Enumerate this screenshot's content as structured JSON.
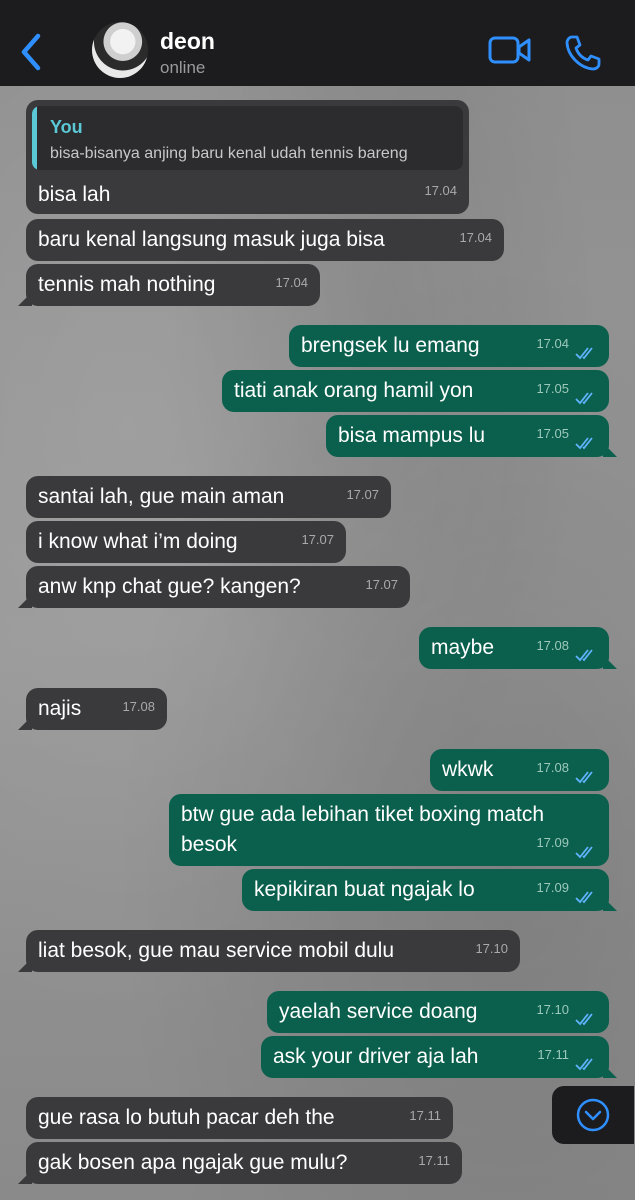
{
  "header": {
    "contact_name": "deon",
    "status": "online",
    "accent": "#2f8fff"
  },
  "quoted": {
    "author": "You",
    "text": "bisa-bisanya anjing baru kenal udah tennis bareng"
  },
  "messages": [
    {
      "dir": "in",
      "text": "bisa lah",
      "time": "17.04"
    },
    {
      "dir": "in",
      "text": "baru kenal langsung masuk juga bisa",
      "time": "17.04"
    },
    {
      "dir": "in",
      "text": "tennis mah nothing",
      "time": "17.04"
    },
    {
      "dir": "out",
      "text": "brengsek lu emang",
      "time": "17.04"
    },
    {
      "dir": "out",
      "text": "tiati anak orang hamil yon",
      "time": "17.05"
    },
    {
      "dir": "out",
      "text": "bisa mampus lu",
      "time": "17.05"
    },
    {
      "dir": "in",
      "text": "santai lah, gue main aman",
      "time": "17.07"
    },
    {
      "dir": "in",
      "text": "i know what i’m doing",
      "time": "17.07"
    },
    {
      "dir": "in",
      "text": "anw knp chat gue? kangen?",
      "time": "17.07"
    },
    {
      "dir": "out",
      "text": "maybe",
      "time": "17.08"
    },
    {
      "dir": "in",
      "text": "najis",
      "time": "17.08"
    },
    {
      "dir": "out",
      "text": "wkwk",
      "time": "17.08"
    },
    {
      "dir": "out",
      "text": "btw gue ada lebihan tiket boxing match besok",
      "time": "17.09"
    },
    {
      "dir": "out",
      "text": "kepikiran buat ngajak lo",
      "time": "17.09"
    },
    {
      "dir": "in",
      "text": "liat besok, gue mau service mobil dulu",
      "time": "17.10"
    },
    {
      "dir": "out",
      "text": "yaelah service doang",
      "time": "17.10"
    },
    {
      "dir": "out",
      "text": "ask your driver aja lah",
      "time": "17.11"
    },
    {
      "dir": "in",
      "text": "gue rasa lo butuh pacar deh the",
      "time": "17.11"
    },
    {
      "dir": "in",
      "text": "gak bosen apa ngajak gue mulu?",
      "time": "17.11"
    }
  ]
}
